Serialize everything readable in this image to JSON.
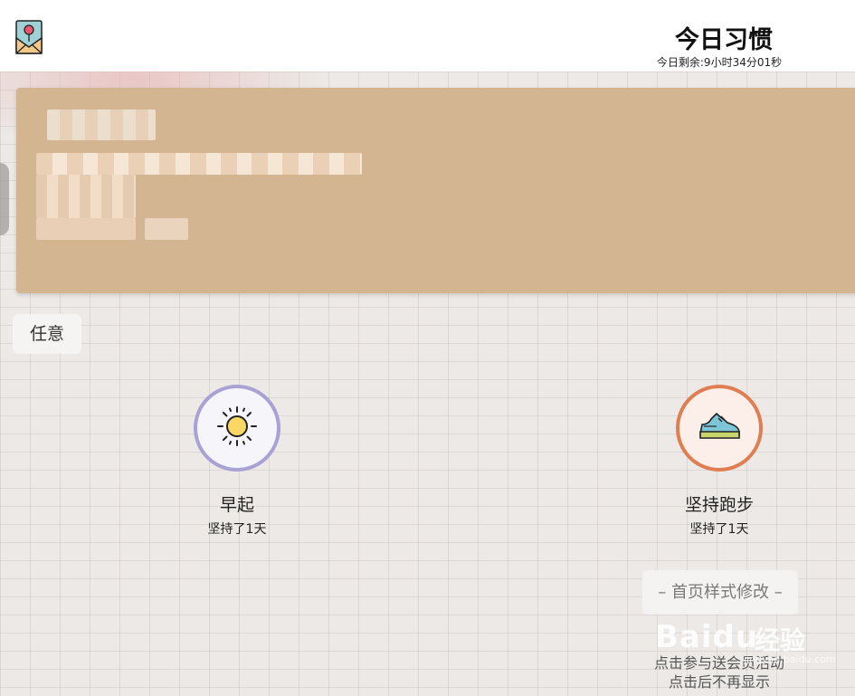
{
  "header": {
    "title": "今日习惯",
    "countdown": "今日剩余:9小时34分01秒"
  },
  "category_chip": "任意",
  "habits": [
    {
      "name": "早起",
      "days": "坚持了1天",
      "icon": "sun-icon",
      "ring_color": "#a9a2d4"
    },
    {
      "name": "坚持跑步",
      "days": "坚持了1天",
      "icon": "sneaker-icon",
      "ring_color": "#e07e53"
    }
  ],
  "style_button": "– 首页样式修改 –",
  "promo": {
    "line1": "点击参与送会员活动",
    "line2": "点击后不再显示"
  },
  "watermark": {
    "text": "Baidu",
    "cn": "经验",
    "url": "jingyan.baidu.com"
  },
  "colors": {
    "banner": "#d3b591",
    "paper": "#ece9e6"
  }
}
